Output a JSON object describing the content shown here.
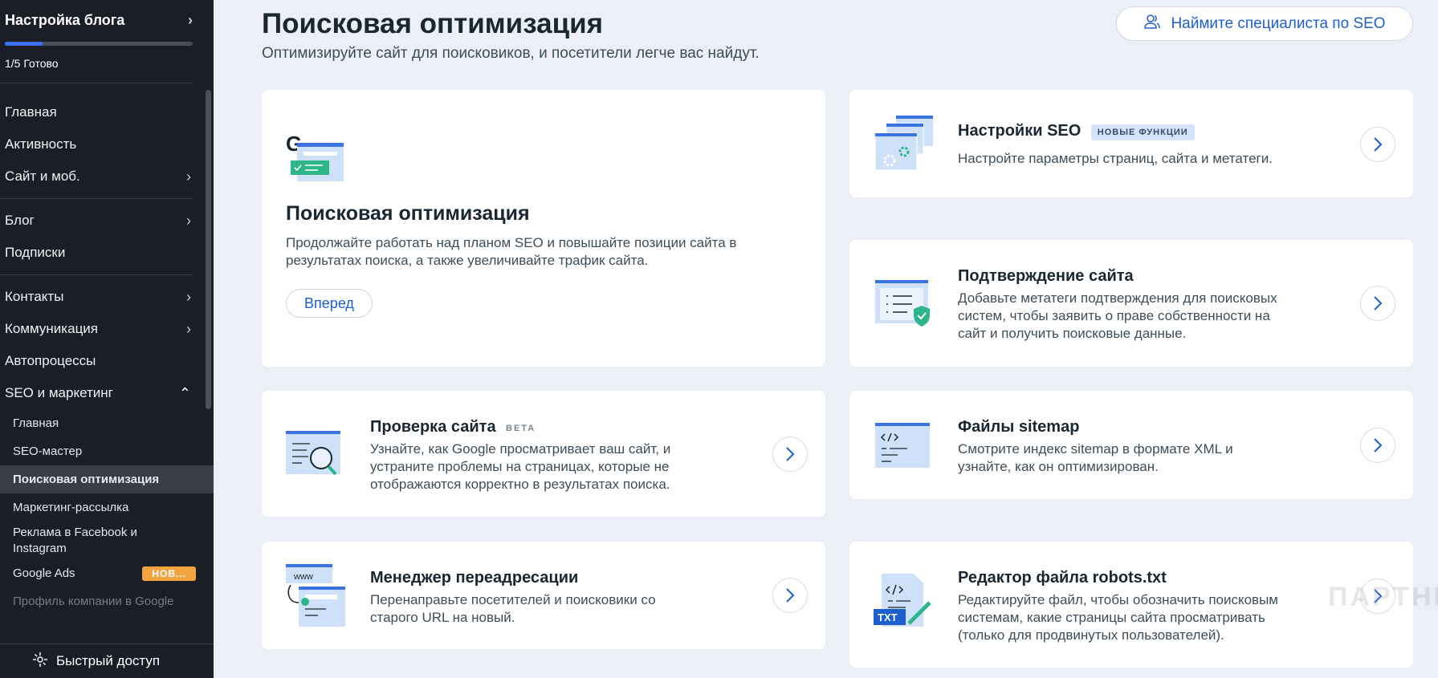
{
  "sidebar": {
    "title": "Настройка блога",
    "progress_text": "1/5 Готово",
    "progress_fraction": 0.2,
    "items_group1": [
      {
        "label": "Главная",
        "chevron": false
      },
      {
        "label": "Активность",
        "chevron": false
      },
      {
        "label": "Сайт и моб.",
        "chevron": true
      }
    ],
    "items_group2": [
      {
        "label": "Блог",
        "chevron": true
      },
      {
        "label": "Подписки",
        "chevron": false
      }
    ],
    "items_group3": [
      {
        "label": "Контакты",
        "chevron": true
      },
      {
        "label": "Коммуникация",
        "chevron": true
      },
      {
        "label": "Автопроцессы",
        "chevron": false
      },
      {
        "label": "SEO и маркетинг",
        "chevron": "up"
      }
    ],
    "sub_items": [
      {
        "label": "Главная"
      },
      {
        "label": "SEO-мастер"
      },
      {
        "label": "Поисковая оптимизация",
        "active": true
      },
      {
        "label": "Маркетинг-рассылка"
      },
      {
        "label": "Реклама в Facebook и Instagram",
        "two": true
      },
      {
        "label": "Google Ads",
        "badge": "НОВ..."
      },
      {
        "label": "Профиль компании в Google",
        "muted": true
      }
    ],
    "quick_access": "Быстрый доступ"
  },
  "header": {
    "title": "Поисковая оптимизация",
    "subtitle": "Оптимизируйте сайт для поисковиков, и посетители легче вас найдут.",
    "find_expert": "Наймите специалиста по SEO"
  },
  "hero": {
    "title": "Поисковая оптимизация",
    "desc_line1": "Продолжайте работать над планом SEO и повышайте позиции сайта в",
    "desc_line2": "результатах поиска, а также увеличивайте трафик сайта.",
    "button": "Вперед",
    "g_letter": "G"
  },
  "cards": {
    "seo_settings": {
      "title": "Настройки SEO",
      "badge": "НОВЫЕ ФУНКЦИИ",
      "desc": [
        "Настройте параметры страниц, сайта и метатеги."
      ]
    },
    "site_verify": {
      "title": "Подтверждение сайта",
      "desc": [
        "Добавьте метатеги подтверждения для поисковых",
        "систем, чтобы заявить о праве собственности на",
        "сайт и получить поисковые данные."
      ]
    },
    "site_check": {
      "title": "Проверка сайта",
      "badge": "BETA",
      "desc": [
        "Узнайте, как Google просматривает ваш сайт, и",
        "устраните проблемы на страницах, которые не",
        "отображаются корректно в результатах поиска."
      ]
    },
    "sitemap": {
      "title": "Файлы sitemap",
      "desc": [
        "Смотрите индекс sitemap в формате XML и",
        "узнайте, как он оптимизирован."
      ]
    },
    "redirects": {
      "title": "Менеджер переадресации",
      "desc": [
        "Перенаправьте посетителей и поисковики со",
        "старого URL на новый."
      ],
      "www": "www"
    },
    "robots": {
      "title": "Редактор файла robots.txt",
      "desc": [
        "Редактируйте файл, чтобы обозначить поисковым",
        "системам, какие страницы сайта просматривать",
        "(только для продвинутых пользователей)."
      ],
      "txt": "TXT"
    }
  },
  "watermark": "ПАРТНЕРКИН",
  "colors": {
    "accent": "#1d5fcc",
    "sidebar_bg": "#1b1e27",
    "page_bg": "#eceff5",
    "badge_orange": "#f2a440",
    "illus_blue": "#3b73e0",
    "illus_light": "#cfe1f9",
    "illus_green": "#2fb58a"
  }
}
